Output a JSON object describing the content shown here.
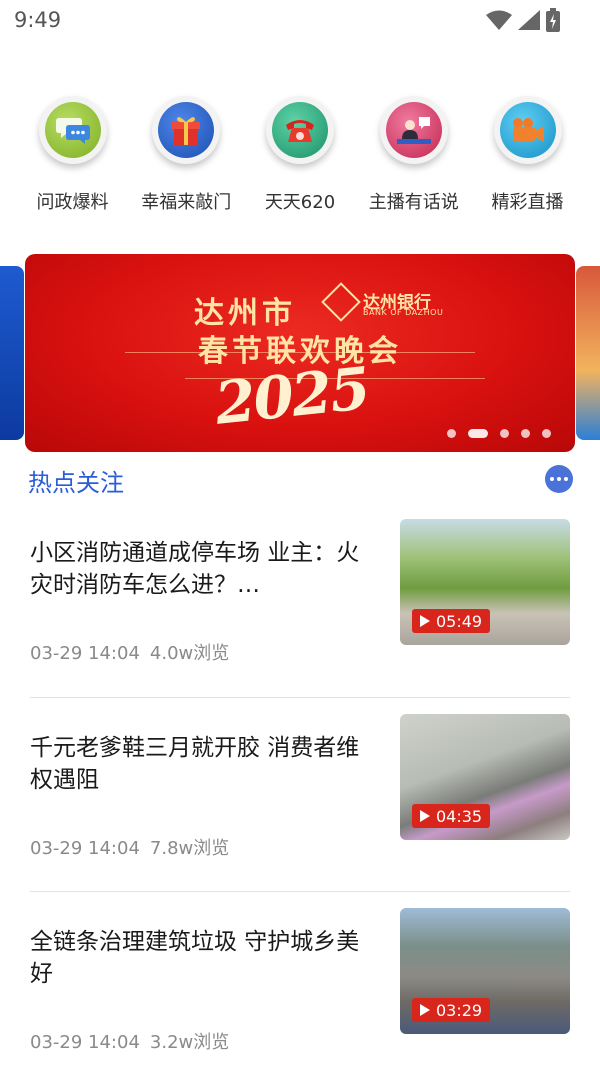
{
  "status_bar": {
    "time": "9:49"
  },
  "quick_entries": [
    {
      "label": "问政爆料",
      "icon": "chat-bubble-icon",
      "color": "#8fbf3a"
    },
    {
      "label": "幸福来敲门",
      "icon": "gift-box-icon",
      "color": "#2b5fc7"
    },
    {
      "label": "天天620",
      "icon": "telephone-icon",
      "color": "#27a37a"
    },
    {
      "label": "主播有话说",
      "icon": "anchor-desk-icon",
      "color": "#d83a6a"
    },
    {
      "label": "精彩直播",
      "icon": "video-camera-icon",
      "color": "#1fa6d6"
    }
  ],
  "banner": {
    "title_line1": "达州市",
    "title_line2": "春节联欢晚会",
    "bank_name": "达州银行",
    "bank_name_en": "BANK OF DAZHOU",
    "year": "2025",
    "slide_count": 5,
    "active_slide": 2
  },
  "section": {
    "title": "热点关注"
  },
  "news": [
    {
      "title": "小区消防通道成停车场 业主：火灾时消防车怎么进？…",
      "date": "03-29 14:04",
      "views": "4.0w浏览",
      "duration": "05:49"
    },
    {
      "title": "千元老爹鞋三月就开胶 消费者维权遇阻",
      "date": "03-29 14:04",
      "views": "7.8w浏览",
      "duration": "04:35"
    },
    {
      "title": "全链条治理建筑垃圾 守护城乡美好",
      "date": "03-29 14:04",
      "views": "3.2w浏览",
      "duration": "03:29"
    }
  ]
}
